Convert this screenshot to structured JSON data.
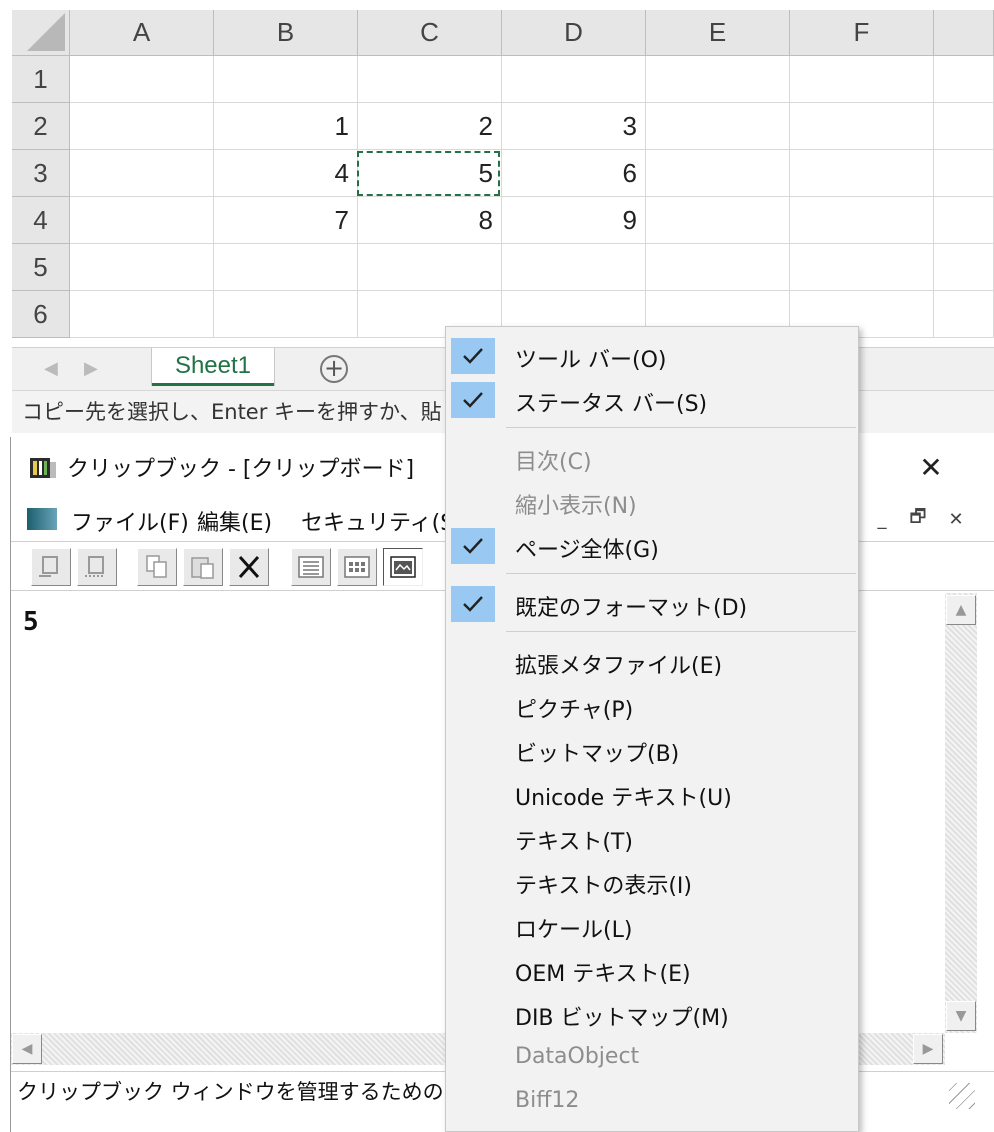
{
  "excel": {
    "columns": [
      "A",
      "B",
      "C",
      "D",
      "E",
      "F"
    ],
    "rows": [
      "1",
      "2",
      "3",
      "4",
      "5",
      "6"
    ],
    "cells": [
      {
        "row": 2,
        "col": "B",
        "value": "1"
      },
      {
        "row": 2,
        "col": "C",
        "value": "2"
      },
      {
        "row": 2,
        "col": "D",
        "value": "3"
      },
      {
        "row": 3,
        "col": "B",
        "value": "4"
      },
      {
        "row": 3,
        "col": "C",
        "value": "5"
      },
      {
        "row": 3,
        "col": "D",
        "value": "6"
      },
      {
        "row": 4,
        "col": "B",
        "value": "7"
      },
      {
        "row": 4,
        "col": "C",
        "value": "8"
      },
      {
        "row": 4,
        "col": "D",
        "value": "9"
      }
    ],
    "copied_cell": "C3",
    "sheet_tab": "Sheet1",
    "add_sheet_symbol": "+",
    "status_text": "コピー先を選択し、Enter キーを押すか、貼り付"
  },
  "clipbook": {
    "title": "クリップブック - [クリップボード]",
    "close_symbol": "✕",
    "menus": [
      "ファイル(F)",
      "編集(E)",
      "セキュリティ(S)"
    ],
    "mdi_buttons": [
      "_",
      "🗗",
      "✕"
    ],
    "content_text": "5",
    "status_text": "クリップブック ウィンドウを管理するためのコマンド"
  },
  "context_menu": {
    "items": [
      {
        "label": "ツール バー(O)",
        "checked": true,
        "enabled": true
      },
      {
        "label": "ステータス バー(S)",
        "checked": true,
        "enabled": true
      },
      {
        "label": "目次(C)",
        "checked": false,
        "enabled": false
      },
      {
        "label": "縮小表示(N)",
        "checked": false,
        "enabled": false
      },
      {
        "label": "ページ全体(G)",
        "checked": true,
        "enabled": true
      },
      {
        "label": "既定のフォーマット(D)",
        "checked": true,
        "enabled": true
      },
      {
        "label": "拡張メタファイル(E)",
        "checked": false,
        "enabled": true
      },
      {
        "label": "ピクチャ(P)",
        "checked": false,
        "enabled": true
      },
      {
        "label": "ビットマップ(B)",
        "checked": false,
        "enabled": true
      },
      {
        "label": "Unicode テキスト(U)",
        "checked": false,
        "enabled": true
      },
      {
        "label": "テキスト(T)",
        "checked": false,
        "enabled": true
      },
      {
        "label": "テキストの表示(I)",
        "checked": false,
        "enabled": true
      },
      {
        "label": "ロケール(L)",
        "checked": false,
        "enabled": true
      },
      {
        "label": "OEM テキスト(E)",
        "checked": false,
        "enabled": true
      },
      {
        "label": "DIB ビットマップ(M)",
        "checked": false,
        "enabled": true
      },
      {
        "label": "DataObject",
        "checked": false,
        "enabled": false
      },
      {
        "label": "Biff12",
        "checked": false,
        "enabled": false
      }
    ]
  },
  "colors": {
    "excel_green": "#217346",
    "menu_check_bg": "#99c9f3",
    "disabled_text": "#8d8d8d"
  }
}
